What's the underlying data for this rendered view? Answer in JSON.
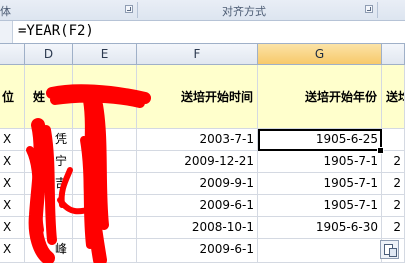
{
  "ribbon": {
    "font_group_label": "体",
    "alignment_group_label": "对齐方式"
  },
  "formula_bar": {
    "content": "=YEAR(F2)"
  },
  "columns": [
    "D",
    "E",
    "F",
    "G"
  ],
  "header_row": {
    "c_partial": "位",
    "d_partial": "姓",
    "f": "送培开始时间",
    "g": "送培开始年份",
    "h_partial": "送均"
  },
  "rows": [
    {
      "c": "X",
      "d": "凭",
      "f": "2003-7-1",
      "g": "1905-6-25",
      "h": ""
    },
    {
      "c": "X",
      "d": "宁",
      "f": "2009-12-21",
      "g": "1905-7-1",
      "h": "2"
    },
    {
      "c": "X",
      "d": "吉",
      "f": "2009-9-1",
      "g": "1905-7-1",
      "h": "2"
    },
    {
      "c": "X",
      "d": "",
      "f": "2009-6-1",
      "g": "1905-7-1",
      "h": "2"
    },
    {
      "c": "X",
      "d": "",
      "f": "2008-10-1",
      "g": "1905-6-30",
      "h": "2"
    },
    {
      "c": "X",
      "d": "峰",
      "f": "2009-6-1",
      "g": "",
      "h": ""
    }
  ],
  "colors": {
    "header_fill": "#ffffcc",
    "selected_column_header": "#f7c96a",
    "redaction": "#ff0000"
  }
}
